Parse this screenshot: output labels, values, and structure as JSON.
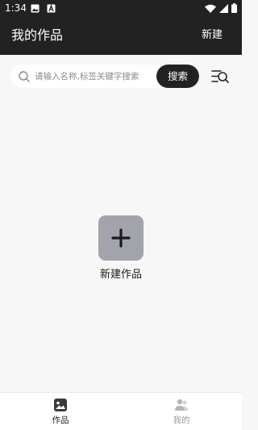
{
  "status_bar": {
    "time": "1:34",
    "left_icons": [
      "gallery-notification-icon",
      "text-notification-icon"
    ],
    "right_icons": [
      "wifi-icon",
      "signal-icon",
      "battery-icon"
    ]
  },
  "header": {
    "title": "我的作品",
    "new_label": "新建"
  },
  "search": {
    "placeholder": "请输入名称,标签关键字搜索",
    "value": "",
    "button_label": "搜索",
    "filter_icon": "filter-search-icon"
  },
  "empty_state": {
    "icon": "plus-icon",
    "label": "新建作品"
  },
  "bottom_nav": {
    "items": [
      {
        "label": "作品",
        "icon": "gallery-icon",
        "active": true
      },
      {
        "label": "我的",
        "icon": "user-group-icon",
        "active": false
      }
    ]
  },
  "colors": {
    "header_bg": "#222222",
    "page_bg": "#f7f7f7",
    "tile_bg": "#a3a3ab",
    "active_text": "#222222",
    "inactive_text": "#9a9a9a"
  }
}
